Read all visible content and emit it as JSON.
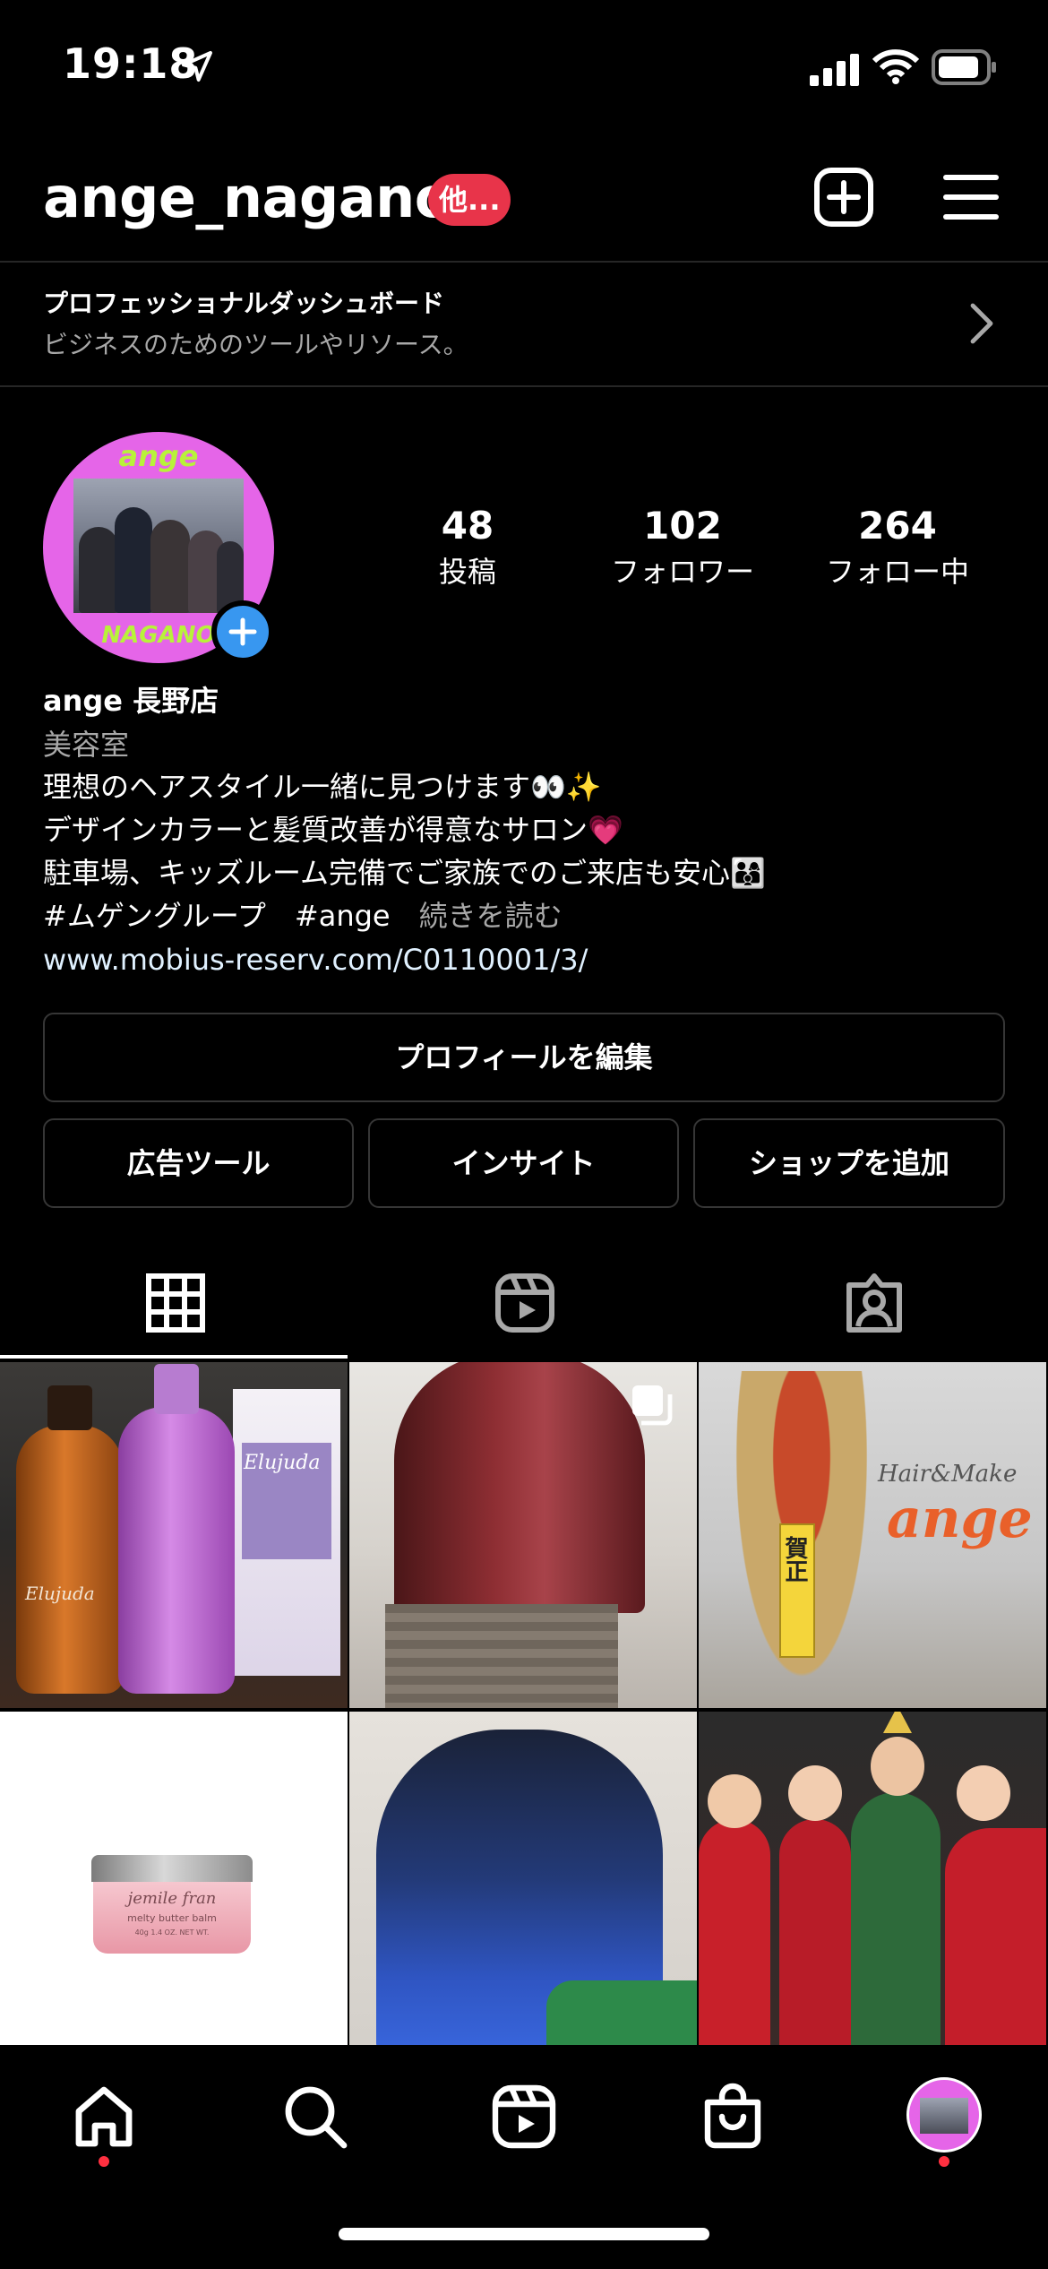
{
  "status_bar": {
    "time": "19:18"
  },
  "header": {
    "username": "ange_nagano",
    "badge": "他..."
  },
  "dashboard": {
    "title": "プロフェッショナルダッシュボード",
    "subtitle": "ビジネスのためのツールやリソース。"
  },
  "profile": {
    "avatar_text_top": "ange",
    "avatar_text_bottom": "NAGANO",
    "stats": [
      {
        "value": "48",
        "label": "投稿"
      },
      {
        "value": "102",
        "label": "フォロワー"
      },
      {
        "value": "264",
        "label": "フォロー中"
      }
    ]
  },
  "bio": {
    "name": "ange 長野店",
    "category": "美容室",
    "line1": "理想のヘアスタイル一緒に見つけます👀✨",
    "line2": "デザインカラーと髪質改善が得意なサロン💗",
    "line3": "駐車場、キッズルーム完備でご家族でのご来店も安心👨‍👩‍👦",
    "hashtags": " #ムゲングループ　#ange　",
    "more": "続きを読む",
    "link": "www.mobius-reserv.com/C0110001/3/"
  },
  "buttons": {
    "edit_profile": "プロフィールを編集",
    "ad_tools": "広告ツール",
    "insights": "インサイト",
    "add_shop": "ショップを追加"
  },
  "grid_posts": [
    {
      "caption_a": "Elujuda",
      "caption_b": "Elujuda"
    },
    {
      "caption_a": ""
    },
    {
      "caption_a": "賀正",
      "caption_b": "Hair&Make",
      "caption_c": "ange"
    },
    {
      "caption_a": "jemile fran",
      "caption_b": "melty butter balm",
      "caption_c": "40g 1.4 OZ. NET WT."
    },
    {
      "caption_a": ""
    },
    {
      "caption_a": ""
    }
  ],
  "colors": {
    "accent_blue": "#3897f0",
    "badge_red": "#e8344a",
    "avatar_pink": "#e565e8",
    "avatar_green": "#b8f23a"
  }
}
